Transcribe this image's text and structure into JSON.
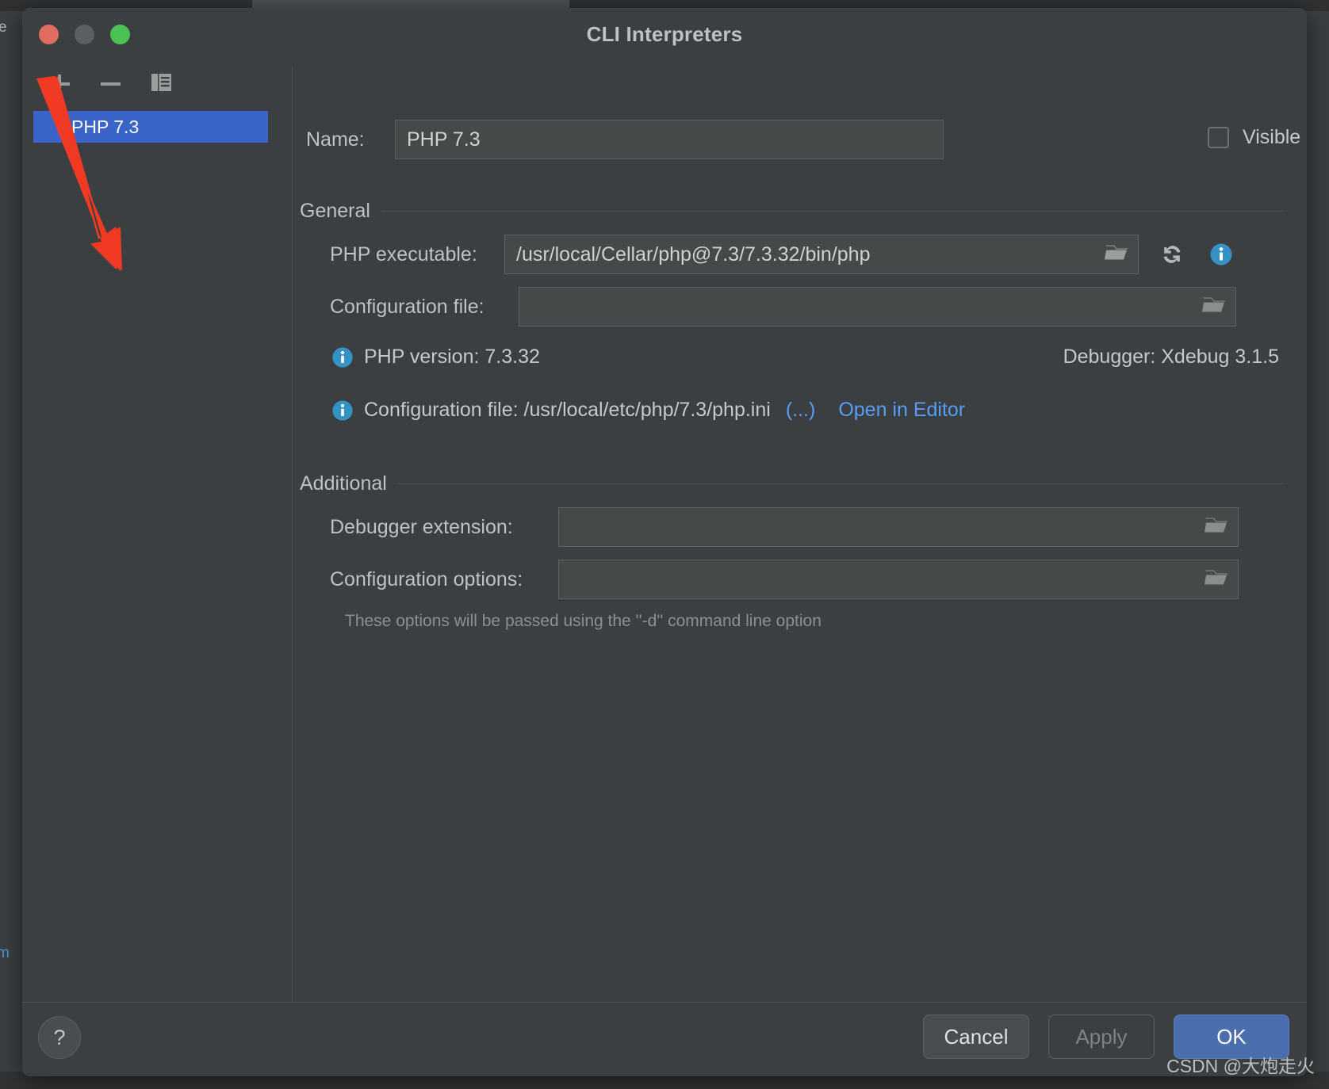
{
  "window": {
    "title": "CLI Interpreters",
    "traffic_lights": [
      "close-red",
      "minimize-yellow",
      "maximize-green"
    ]
  },
  "sidebar": {
    "toolbar": [
      {
        "name": "add",
        "icon": "plus-icon",
        "label": "+"
      },
      {
        "name": "remove",
        "icon": "minus-icon",
        "label": "−"
      },
      {
        "name": "copy",
        "icon": "copy-icon",
        "label": ""
      }
    ],
    "items": [
      {
        "label": "PHP 7.3",
        "selected": true
      }
    ]
  },
  "form": {
    "name_label": "Name:",
    "name_value": "PHP 7.3",
    "visible_only_label": "Visible only for this project",
    "visible_only_checked": false
  },
  "general": {
    "title": "General",
    "php_executable_label": "PHP executable:",
    "php_executable_value": "/usr/local/Cellar/php@7.3/7.3.32/bin/php",
    "configuration_file_label": "Configuration file:",
    "configuration_file_value": "",
    "refresh_icon": "refresh-icon",
    "info_icon": "info-icon",
    "browse_icon": "folder-icon",
    "php_version_text": "PHP version: 7.3.32",
    "debugger_text": "Debugger:  Xdebug 3.1.5",
    "config_file_info_text": "Configuration file: /usr/local/etc/php/7.3/php.ini",
    "config_file_dots_link": "(...)",
    "open_in_editor_link": "Open in Editor"
  },
  "additional": {
    "title": "Additional",
    "debugger_extension_label": "Debugger extension:",
    "debugger_extension_value": "",
    "configuration_options_label": "Configuration options:",
    "configuration_options_value": "",
    "hint": "These options will be passed using the ''-d'' command line option"
  },
  "footer": {
    "help_label": "?",
    "cancel_label": "Cancel",
    "apply_label": "Apply",
    "ok_label": "OK"
  },
  "annotation": {
    "arrow_color": "#f03a24"
  },
  "watermark": {
    "text": "CSDN @大炮走火"
  },
  "background": {
    "left_glyph_top": "e",
    "left_glyph_bottom": "m"
  },
  "colors": {
    "window_bg": "#3c3f41",
    "field_bg": "#45494a",
    "selection_blue": "#3a64c8",
    "link_blue": "#589df6",
    "ok_blue": "#4b6eaf"
  }
}
